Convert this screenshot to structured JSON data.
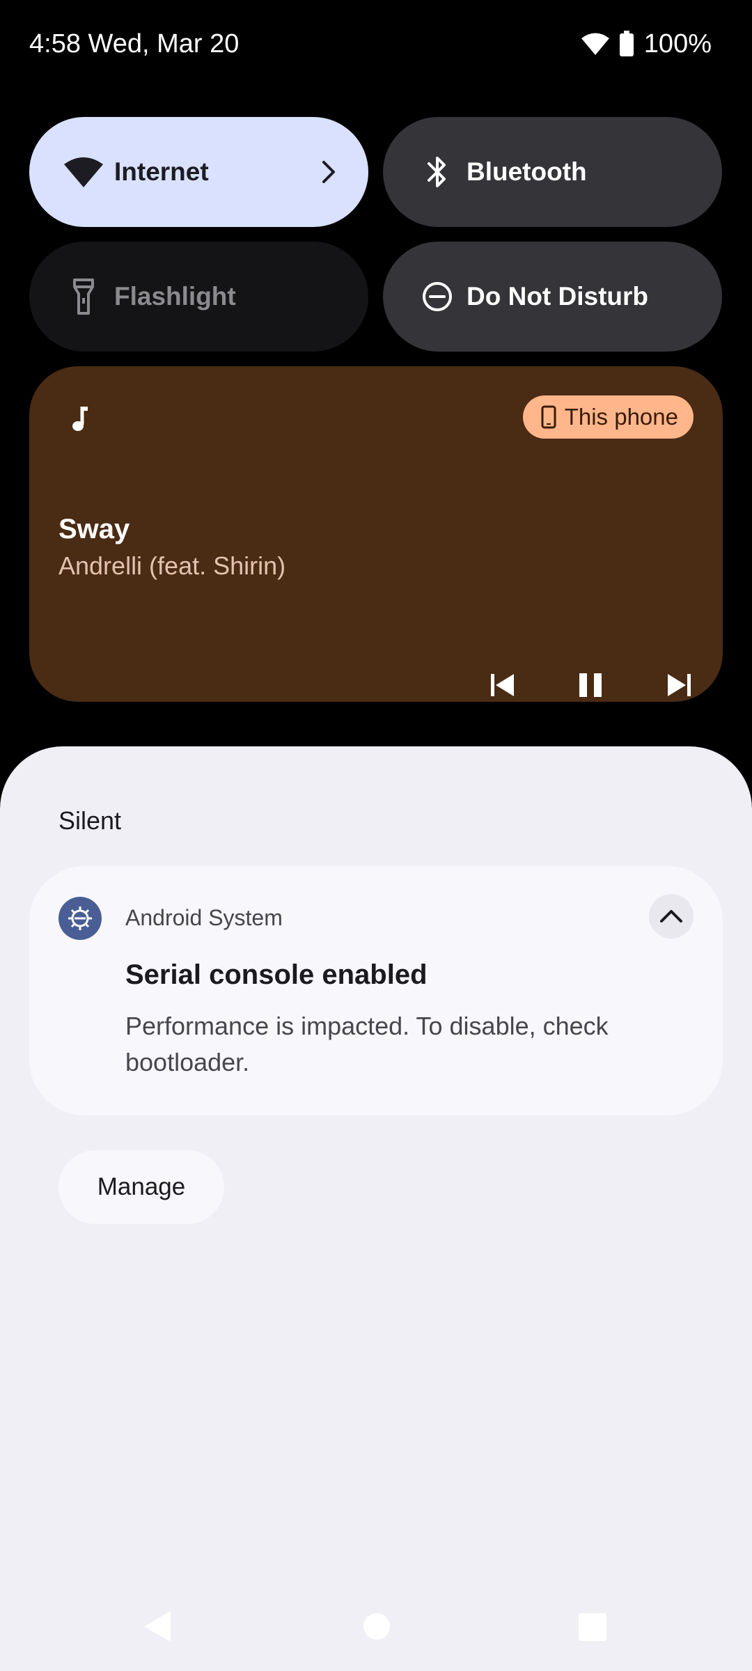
{
  "status_bar": {
    "time_date": "4:58 Wed, Mar 20",
    "battery": "100%",
    "icons": [
      "wifi-icon",
      "battery-icon"
    ]
  },
  "quick_settings": {
    "tiles": [
      {
        "label": "Internet",
        "icon": "wifi-icon",
        "state": "on"
      },
      {
        "label": "Bluetooth",
        "icon": "bluetooth-icon",
        "state": "off"
      },
      {
        "label": "Flashlight",
        "icon": "flashlight-icon",
        "state": "unavailable"
      },
      {
        "label": "Do Not Disturb",
        "icon": "do-not-disturb-icon",
        "state": "off"
      }
    ]
  },
  "media": {
    "title": "Sway",
    "artist": "Andrelli (feat. Shirin)",
    "output_device": "This phone",
    "colors": {
      "background": "#4a2b14",
      "chip": "#ffb68a"
    }
  },
  "notifications": {
    "section_header": "Silent",
    "items": [
      {
        "app_name": "Android System",
        "title": "Serial console enabled",
        "text": "Performance is impacted. To disable, check bootloader."
      }
    ],
    "manage_label": "Manage"
  }
}
